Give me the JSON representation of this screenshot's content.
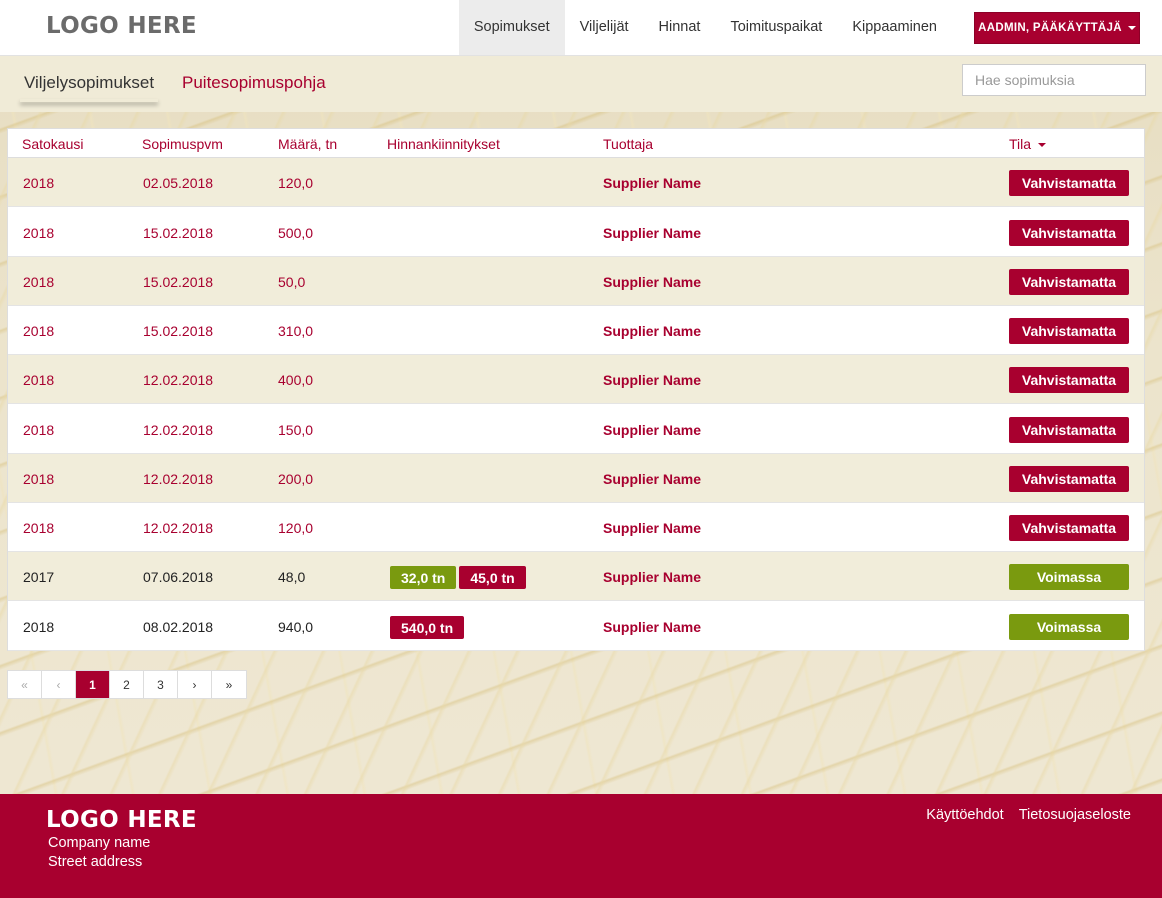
{
  "brand": {
    "logo": "LOGO HERE"
  },
  "nav": {
    "items": [
      {
        "label": "Sopimukset",
        "active": true
      },
      {
        "label": "Viljelijät",
        "active": false
      },
      {
        "label": "Hinnat",
        "active": false
      },
      {
        "label": "Toimituspaikat",
        "active": false
      },
      {
        "label": "Kippaaminen",
        "active": false
      }
    ],
    "user_button": "AADMIN, PÄÄKÄYTTÄJÄ"
  },
  "subnav": {
    "tabs": [
      {
        "label": "Viljelysopimukset",
        "active": true
      },
      {
        "label": "Puitesopimuspohja",
        "active": false
      }
    ],
    "search_placeholder": "Hae sopimuksia"
  },
  "table": {
    "columns": [
      "Satokausi",
      "Sopimuspvm",
      "Määrä, tn",
      "Hinnankiinnitykset",
      "Tuottaja",
      "Tila"
    ],
    "rows": [
      {
        "season": "2018",
        "date": "02.05.2018",
        "amount": "120,0",
        "fixings": [],
        "producer": "Supplier Name",
        "status": "Vahvistamatta",
        "status_type": "pending"
      },
      {
        "season": "2018",
        "date": "15.02.2018",
        "amount": "500,0",
        "fixings": [],
        "producer": "Supplier Name",
        "status": "Vahvistamatta",
        "status_type": "pending"
      },
      {
        "season": "2018",
        "date": "15.02.2018",
        "amount": "50,0",
        "fixings": [],
        "producer": "Supplier Name",
        "status": "Vahvistamatta",
        "status_type": "pending"
      },
      {
        "season": "2018",
        "date": "15.02.2018",
        "amount": "310,0",
        "fixings": [],
        "producer": "Supplier Name",
        "status": "Vahvistamatta",
        "status_type": "pending"
      },
      {
        "season": "2018",
        "date": "12.02.2018",
        "amount": "400,0",
        "fixings": [],
        "producer": "Supplier Name",
        "status": "Vahvistamatta",
        "status_type": "pending"
      },
      {
        "season": "2018",
        "date": "12.02.2018",
        "amount": "150,0",
        "fixings": [],
        "producer": "Supplier Name",
        "status": "Vahvistamatta",
        "status_type": "pending"
      },
      {
        "season": "2018",
        "date": "12.02.2018",
        "amount": "200,0",
        "fixings": [],
        "producer": "Supplier Name",
        "status": "Vahvistamatta",
        "status_type": "pending"
      },
      {
        "season": "2018",
        "date": "12.02.2018",
        "amount": "120,0",
        "fixings": [],
        "producer": "Supplier Name",
        "status": "Vahvistamatta",
        "status_type": "pending"
      },
      {
        "season": "2017",
        "date": "07.06.2018",
        "amount": "48,0",
        "fixings": [
          {
            "label": "32,0 tn",
            "color": "green"
          },
          {
            "label": "45,0 tn",
            "color": "red"
          }
        ],
        "producer": "Supplier Name",
        "status": "Voimassa",
        "status_type": "active"
      },
      {
        "season": "2018",
        "date": "08.02.2018",
        "amount": "940,0",
        "fixings": [
          {
            "label": "540,0 tn",
            "color": "red"
          }
        ],
        "producer": "Supplier Name",
        "status": "Voimassa",
        "status_type": "active"
      }
    ]
  },
  "pagination": {
    "first": "«",
    "prev": "‹",
    "pages": [
      "1",
      "2",
      "3"
    ],
    "current": "1",
    "next": "›",
    "last": "»"
  },
  "footer": {
    "logo": "LOGO HERE",
    "company": "Company name",
    "address": "Street address",
    "links": [
      "Käyttöehdot",
      "Tietosuojaseloste"
    ]
  },
  "colors": {
    "brand": "#a8002f",
    "success": "#7a9a0f",
    "highlight_row": "#f1edda"
  }
}
